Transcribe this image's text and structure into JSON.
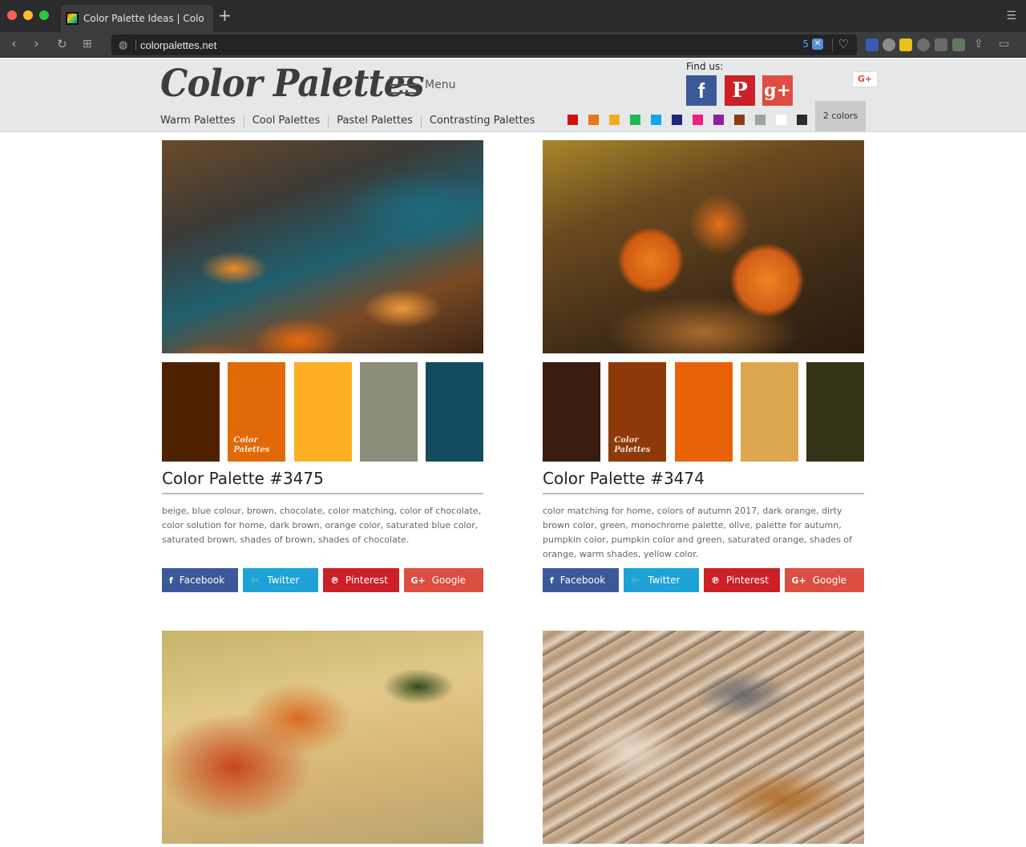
{
  "browser": {
    "tab_title": "Color Palette Ideas | ColorPal",
    "url": "colorpalettes.net",
    "url_count": "5"
  },
  "header": {
    "logo": "Color Palettes",
    "menu_label": "Menu",
    "find_us": "Find us:",
    "gplus_label": "G+",
    "nav": [
      "Warm Palettes",
      "Cool Palettes",
      "Pastel Palettes",
      "Contrasting Palettes"
    ],
    "swatches": [
      "#d0130a",
      "#e77817",
      "#f2ae22",
      "#1fbb54",
      "#10a6eb",
      "#1d2a7a",
      "#f11c86",
      "#8a1fa6",
      "#8a3d10",
      "#9ba4a3",
      "#ffffff",
      "#2b2b2b"
    ],
    "two_colors": "2 colors"
  },
  "palette_logo": "Color Palettes",
  "cards": [
    {
      "title": "Color Palette #3475",
      "colors": [
        "#4e2200",
        "#df6a07",
        "#feaf24",
        "#8a8e7a",
        "#134c5f"
      ],
      "tags": "beige, blue colour, brown, chocolate, color matching, color of chocolate, color solution for home, dark brown, orange color, saturated blue color, saturated brown, shades of brown, shades of chocolate.",
      "share": [
        "Facebook",
        "Twitter",
        "Pinterest",
        "Google"
      ]
    },
    {
      "title": "Color Palette #3474",
      "colors": [
        "#3a1d0e",
        "#8e3908",
        "#e86307",
        "#dca64e",
        "#363418"
      ],
      "tags": "color matching for home, colors of autumn 2017, dark orange, dirty brown color, green, monochrome palette, olive, palette for autumn, pumpkin color, pumpkin color and green, saturated orange, shades of orange, warm shades, yellow color.",
      "share": [
        "Facebook",
        "Twitter",
        "Pinterest",
        "Google"
      ]
    }
  ]
}
